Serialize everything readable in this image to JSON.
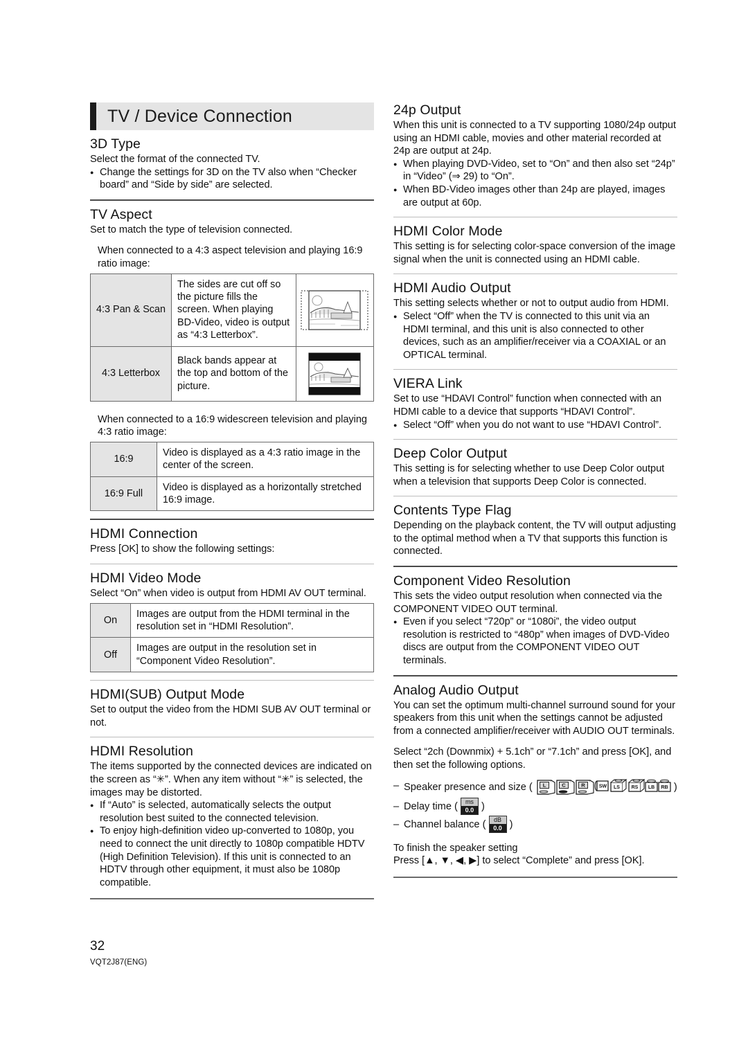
{
  "header": {
    "chapter_title": "TV / Device Connection"
  },
  "footer": {
    "page_number": "32",
    "doc_code": "VQT2J87(ENG)"
  },
  "left_column": {
    "three_d_type": {
      "heading": "3D Type",
      "body": "Select the format of the connected TV.",
      "bullets": [
        "Change the settings for 3D on the TV also when “Checker board” and “Side by side” are selected."
      ]
    },
    "tv_aspect": {
      "heading": "TV Aspect",
      "body": "Set to match the type of television connected.",
      "intro_43": "When connected to a 4:3 aspect television and playing 16:9 ratio image:",
      "table_43": [
        {
          "label": "4:3 Pan & Scan",
          "desc": "The sides are cut off so the picture fills the screen. When playing BD-Video, video is output as “4:3 Letterbox”.",
          "thumb": "pan-scan-thumbnail"
        },
        {
          "label": "4:3 Letterbox",
          "desc": "Black bands appear at the top and bottom of the picture.",
          "thumb": "letterbox-thumbnail"
        }
      ],
      "intro_169": "When connected to a 16:9 widescreen television and playing 4:3 ratio image:",
      "table_169": [
        {
          "label": "16:9",
          "desc": "Video is displayed as a 4:3 ratio image in the center of the screen."
        },
        {
          "label": "16:9 Full",
          "desc": "Video is displayed as a horizontally stretched 16:9 image."
        }
      ]
    },
    "hdmi_connection": {
      "heading": "HDMI Connection",
      "body": "Press [OK] to show the following settings:"
    },
    "hdmi_video_mode": {
      "heading": "HDMI Video Mode",
      "body": "Select “On” when video is output from HDMI AV OUT terminal.",
      "table": [
        {
          "label": "On",
          "desc": "Images are output from the HDMI terminal in the resolution set in “HDMI Resolution”."
        },
        {
          "label": "Off",
          "desc": "Images are output in the resolution set in “Component Video Resolution”."
        }
      ]
    },
    "hdmi_sub_output_mode": {
      "heading": "HDMI(SUB) Output Mode",
      "body": "Set to output the video from the HDMI SUB AV OUT terminal or not."
    },
    "hdmi_resolution": {
      "heading": "HDMI Resolution",
      "body_part1": "The items supported by the connected devices are indicated on the screen as “",
      "asterisk_glyph": "✳",
      "body_part2": "”. When any item without “",
      "body_part3": "” is selected, the images may be distorted.",
      "bullets": [
        "If “Auto” is selected, automatically selects the output resolution best suited to the connected television.",
        "To enjoy high-definition video up-converted to 1080p, you need to connect the unit directly to 1080p compatible HDTV (High Definition Television). If this unit is connected to an HDTV through other equipment, it must also be 1080p compatible."
      ]
    }
  },
  "right_column": {
    "output_24p": {
      "heading": "24p Output",
      "body": "When this unit is connected to a TV supporting 1080/24p output using an HDMI cable, movies and other material recorded at 24p are output at 24p.",
      "bullet_1_part1": "When playing DVD-Video, set to “On” and then also set “24p” in “Video” (",
      "bullet_1_ref_arrow": "⇒",
      "bullet_1_ref_page": "29",
      "bullet_1_part2": ") to “On”.",
      "bullet_2": "When BD-Video images other than 24p are played, images are output at 60p."
    },
    "hdmi_color_mode": {
      "heading": "HDMI Color Mode",
      "body": "This setting is for selecting color-space conversion of the image signal when the unit is connected using an HDMI cable."
    },
    "hdmi_audio_output": {
      "heading": "HDMI Audio Output",
      "body": "This setting selects whether or not to output audio from HDMI.",
      "bullets": [
        "Select “Off” when the TV is connected to this unit via an HDMI terminal, and this unit is also connected to other devices, such as an amplifier/receiver via a COAXIAL or an OPTICAL terminal."
      ]
    },
    "viera_link": {
      "heading": "VIERA Link",
      "body": "Set to use “HDAVI Control” function when connected with an HDMI cable to a device that supports “HDAVI Control”.",
      "bullets": [
        "Select “Off” when you do not want to use “HDAVI Control”."
      ]
    },
    "deep_color_output": {
      "heading": "Deep Color Output",
      "body": "This setting is for selecting whether to use Deep Color output when a television that supports Deep Color is connected."
    },
    "contents_type_flag": {
      "heading": "Contents Type Flag",
      "body": "Depending on the playback content, the TV will output adjusting to the optimal method when a TV that supports this function is connected."
    },
    "component_video_resolution": {
      "heading": "Component Video Resolution",
      "body": "This sets the video output resolution when connected via the COMPONENT VIDEO OUT terminal.",
      "bullets": [
        "Even if you select “720p” or “1080i”, the video output resolution is restricted to “480p” when images of DVD-Video discs are output from the COMPONENT VIDEO OUT terminals."
      ]
    },
    "analog_audio_output": {
      "heading": "Analog Audio Output",
      "body": "You can set the optimum multi-channel surround sound for your speakers from this unit when the settings cannot be adjusted from a connected amplifier/receiver with AUDIO OUT terminals.",
      "select_instruction": "Select “2ch (Downmix) + 5.1ch” or “7.1ch” and press [OK], and then set the following options.",
      "options": [
        {
          "label": "Speaker presence and size",
          "icon": "speaker-set-icons"
        },
        {
          "label": "Delay time",
          "icon": "delay-time-icon"
        },
        {
          "label": "Channel balance",
          "icon": "channel-balance-icon"
        }
      ],
      "speaker_icons": [
        "L",
        "C",
        "R",
        "SW",
        "LS",
        "RS",
        "LB",
        "RB"
      ],
      "delay_icon": {
        "unit": "ms",
        "value": "0.0"
      },
      "balance_icon": {
        "unit": "dB",
        "value": "0.0"
      },
      "finish_heading": "To finish the speaker setting",
      "finish_body_part1": "Press [",
      "finish_keys": [
        "▲",
        "▼",
        "◀",
        "▶"
      ],
      "finish_body_part2": "] to select “Complete” and press [OK]."
    }
  },
  "colors": {
    "banner_bg": "#e4e4e4",
    "banner_bar": "#1b1b1b",
    "table_label_bg": "#e4e4e4",
    "divider_major": "#4a4a4a",
    "divider_minor": "#bdbdbd",
    "text": "#111111"
  }
}
